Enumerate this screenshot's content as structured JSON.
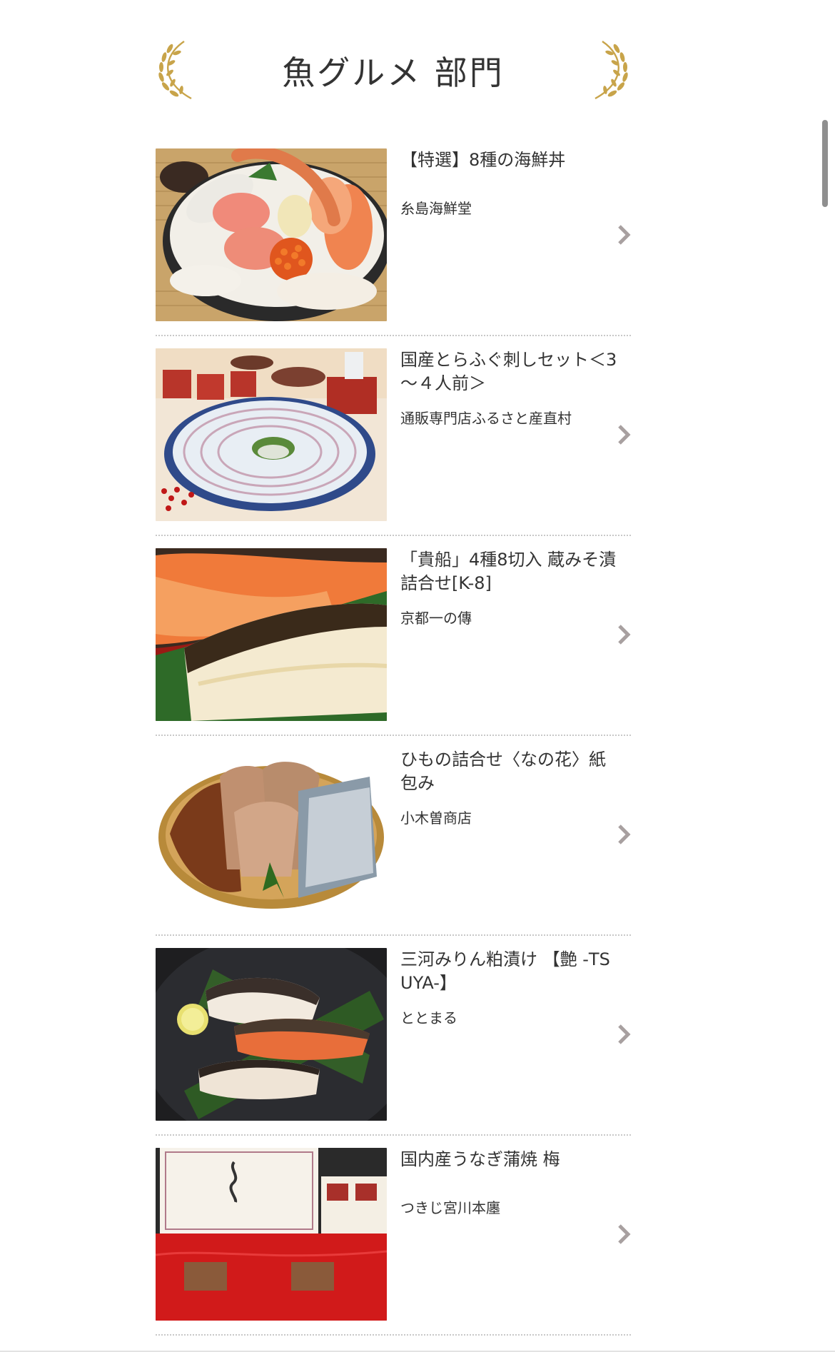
{
  "section": {
    "title": "魚グルメ 部門",
    "laurel_left_icon": "laurel-left-icon",
    "laurel_right_icon": "laurel-right-icon",
    "accent_color": "#c8a44a"
  },
  "items": [
    {
      "title": "【特選】8種の海鮮丼",
      "shop": "糸島海鮮堂",
      "image": "seafood-bowl-image"
    },
    {
      "title": "国産とらふぐ刺しセット＜3～４人前＞",
      "shop": "通販専門店ふるさと産直村",
      "image": "fugu-sashimi-image"
    },
    {
      "title": "「貴船」4種8切入 蔵みそ漬 詰合せ[K-8]",
      "shop": "京都一の傳",
      "image": "miso-fish-image"
    },
    {
      "title": "ひもの詰合せ〈なの花〉紙包み",
      "shop": "小木曽商店",
      "image": "dried-fish-image"
    },
    {
      "title": "三河みりん粕漬け 【艶 -TSUYA-】",
      "shop": "ととまる",
      "image": "kasuzuke-image"
    },
    {
      "title": "国内産うなぎ蒲焼 梅",
      "shop": "つきじ宮川本廛",
      "image": "unagi-box-image"
    }
  ],
  "colors": {
    "text": "#333333",
    "chevron": "#a8a0a0",
    "divider": "#c8c8c8"
  }
}
